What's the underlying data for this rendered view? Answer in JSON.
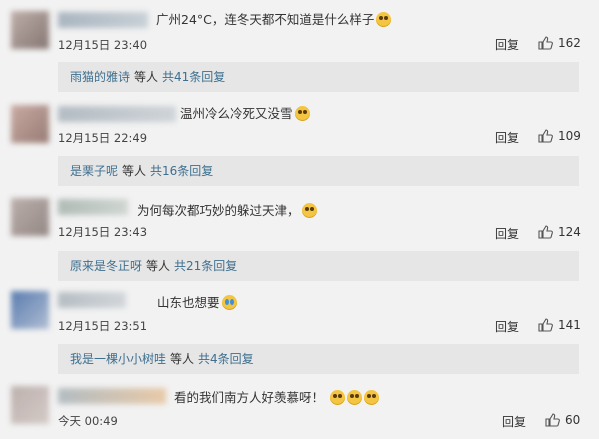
{
  "comments": [
    {
      "text": "广州24°C，连冬天都不知道是什么样子",
      "emoji": "laugh-cry-emoji",
      "time": "12月15日 23:40",
      "reply_label": "回复",
      "likes": "162",
      "reply_user": "雨猫的雅诗",
      "reply_mid": "等人",
      "reply_count": "共41条回复"
    },
    {
      "text": "温州冷么冷死又没雪",
      "emoji": "pleading-emoji",
      "time": "12月15日 22:49",
      "reply_label": "回复",
      "likes": "109",
      "reply_user": "是栗子呢",
      "reply_mid": "等人",
      "reply_count": "共16条回复"
    },
    {
      "text": "为何每次都巧妙的躲过天津，",
      "emoji": "pleading-emoji",
      "time": "12月15日 23:43",
      "reply_label": "回复",
      "likes": "124",
      "reply_user": "原来是冬正呀",
      "reply_mid": "等人",
      "reply_count": "共21条回复"
    },
    {
      "text": "山东也想要",
      "emoji": "crying-emoji",
      "time": "12月15日 23:51",
      "reply_label": "回复",
      "likes": "141",
      "reply_user": "我是一棵小小树哇",
      "reply_mid": "等人",
      "reply_count": "共4条回复"
    },
    {
      "text": "看的我们南方人好羡慕呀！",
      "emoji": "scared-emoji",
      "time": "今天 00:49",
      "reply_label": "回复",
      "likes": "60"
    }
  ]
}
